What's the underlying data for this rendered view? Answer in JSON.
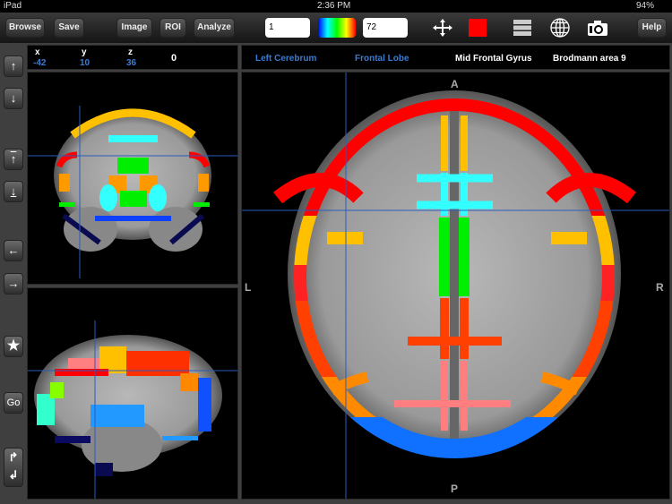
{
  "status_bar": {
    "device": "iPad",
    "time": "2:36 PM",
    "battery": "94%"
  },
  "toolbar": {
    "browse": "Browse",
    "save": "Save",
    "image": "Image",
    "roi": "ROI",
    "analyze": "Analyze",
    "min_value": "1",
    "max_value": "72",
    "help": "Help",
    "icons": [
      "move-crosshair-icon",
      "color-square-icon",
      "layers-icon",
      "globe-icon",
      "camera-icon"
    ],
    "roi_color": "#ff0000"
  },
  "sidebar": {
    "buttons": [
      "arrow-up",
      "arrow-down",
      "arrow-up-top",
      "arrow-down-bottom",
      "arrow-left",
      "arrow-right",
      "star"
    ],
    "go": "Go"
  },
  "coords": {
    "x_label": "x",
    "y_label": "y",
    "z_label": "z",
    "x": "-42",
    "y": "10",
    "z": "36",
    "value": "0"
  },
  "labels": {
    "hemisphere": "Left Cerebrum",
    "lobe": "Frontal Lobe",
    "gyrus": "Mid Frontal Gyrus",
    "brodmann": "Brodmann area 9"
  },
  "axial": {
    "anterior": "A",
    "posterior": "P",
    "left": "L",
    "right": "R"
  },
  "colors": {
    "crosshair": "#2a5cc0",
    "label_blue": "#3a7bd5"
  }
}
